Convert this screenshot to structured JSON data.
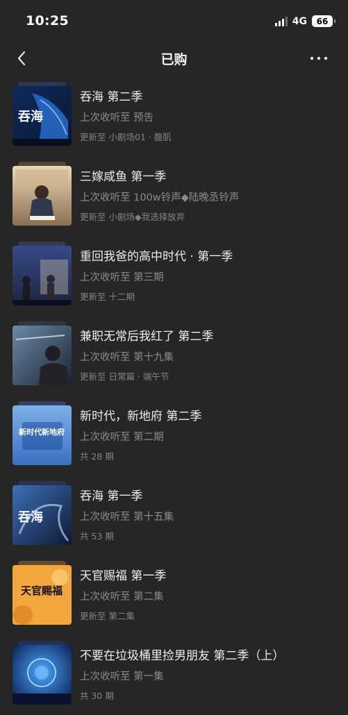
{
  "status_bar": {
    "time": "10:25",
    "network": "4G",
    "battery": "66"
  },
  "nav": {
    "title": "已购",
    "back_icon": "chevron-left-icon",
    "more_icon": "more-horizontal-icon"
  },
  "items": [
    {
      "title": "吞海 第二季",
      "last_listened": "上次收听至 预告",
      "update": "更新至 小剧场01 · 腹肌",
      "cover_text": "吞海"
    },
    {
      "title": "三嫁咸鱼 第一季",
      "last_listened": "上次收听至 100w铃声◆陆晚丞铃声",
      "update": "更新至 小剧场◆我选择放弃",
      "cover_text": ""
    },
    {
      "title": "重回我爸的高中时代 · 第一季",
      "last_listened": "上次收听至 第三期",
      "update": "更新至 十二期",
      "cover_text": ""
    },
    {
      "title": "兼职无常后我红了 第二季",
      "last_listened": "上次收听至 第十九集",
      "update": "更新至 日常篇 · 端午节",
      "cover_text": ""
    },
    {
      "title": "新时代，新地府 第二季",
      "last_listened": "上次收听至 第二期",
      "update": "共 28 期",
      "cover_text": "新时代新地府"
    },
    {
      "title": "吞海 第一季",
      "last_listened": "上次收听至 第十五集",
      "update": "共 53 期",
      "cover_text": "吞海"
    },
    {
      "title": "天官赐福 第一季",
      "last_listened": "上次收听至 第二集",
      "update": "更新至 第二集",
      "cover_text": "天官赐福"
    },
    {
      "title": "不要在垃圾桶里捡男朋友 第二季（上）",
      "last_listened": "上次收听至 第一集",
      "update": "共 30 期",
      "cover_text": ""
    }
  ]
}
